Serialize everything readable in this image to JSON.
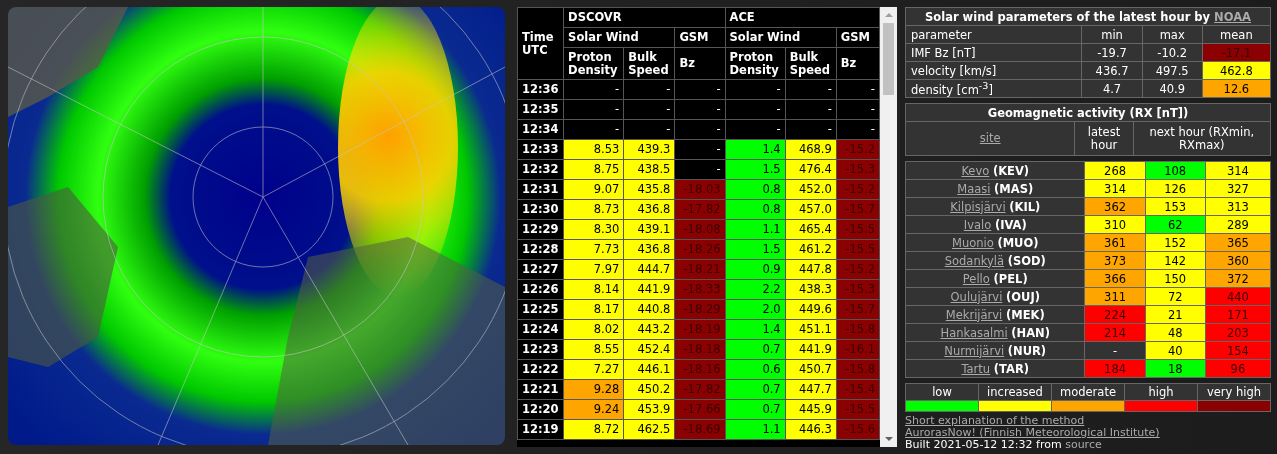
{
  "solar_table": {
    "col_time": "Time UTC",
    "groups": [
      "DSCOVR",
      "ACE"
    ],
    "subgroups": [
      "Solar Wind",
      "GSM",
      "Solar Wind",
      "GSM"
    ],
    "columns": [
      "Proton Density",
      "Bulk Speed",
      "Bz",
      "Proton Density",
      "Bulk Speed",
      "Bz"
    ],
    "rows": [
      {
        "time": "12:36",
        "cells": [
          {
            "value": "-"
          },
          {
            "value": "-"
          },
          {
            "value": "-"
          },
          {
            "value": "-"
          },
          {
            "value": "-"
          },
          {
            "value": "-"
          }
        ]
      },
      {
        "time": "12:35",
        "cells": [
          {
            "value": "-"
          },
          {
            "value": "-"
          },
          {
            "value": "-"
          },
          {
            "value": "-"
          },
          {
            "value": "-"
          },
          {
            "value": "-"
          }
        ]
      },
      {
        "time": "12:34",
        "cells": [
          {
            "value": "-"
          },
          {
            "value": "-"
          },
          {
            "value": "-"
          },
          {
            "value": "-"
          },
          {
            "value": "-"
          },
          {
            "value": "-"
          }
        ]
      },
      {
        "time": "12:33",
        "cells": [
          {
            "value": "8.53",
            "color": "#ffff00"
          },
          {
            "value": "439.3",
            "color": "#ffff00"
          },
          {
            "value": "-"
          },
          {
            "value": "1.4",
            "color": "#00ff00"
          },
          {
            "value": "468.9",
            "color": "#ffff00"
          },
          {
            "value": "-15.2",
            "color": "#8b0000"
          }
        ]
      },
      {
        "time": "12:32",
        "cells": [
          {
            "value": "8.75",
            "color": "#ffff00"
          },
          {
            "value": "438.5",
            "color": "#ffff00"
          },
          {
            "value": "-"
          },
          {
            "value": "1.5",
            "color": "#00ff00"
          },
          {
            "value": "476.4",
            "color": "#ffff00"
          },
          {
            "value": "-15.3",
            "color": "#8b0000"
          }
        ]
      },
      {
        "time": "12:31",
        "cells": [
          {
            "value": "9.07",
            "color": "#ffff00"
          },
          {
            "value": "435.8",
            "color": "#ffff00"
          },
          {
            "value": "-18.03",
            "color": "#8b0000"
          },
          {
            "value": "0.8",
            "color": "#00ff00"
          },
          {
            "value": "452.0",
            "color": "#ffff00"
          },
          {
            "value": "-15.2",
            "color": "#8b0000"
          }
        ]
      },
      {
        "time": "12:30",
        "cells": [
          {
            "value": "8.73",
            "color": "#ffff00"
          },
          {
            "value": "436.8",
            "color": "#ffff00"
          },
          {
            "value": "-17.82",
            "color": "#8b0000"
          },
          {
            "value": "0.8",
            "color": "#00ff00"
          },
          {
            "value": "457.0",
            "color": "#ffff00"
          },
          {
            "value": "-15.7",
            "color": "#8b0000"
          }
        ]
      },
      {
        "time": "12:29",
        "cells": [
          {
            "value": "8.30",
            "color": "#ffff00"
          },
          {
            "value": "439.1",
            "color": "#ffff00"
          },
          {
            "value": "-18.08",
            "color": "#8b0000"
          },
          {
            "value": "1.1",
            "color": "#00ff00"
          },
          {
            "value": "465.4",
            "color": "#ffff00"
          },
          {
            "value": "-15.5",
            "color": "#8b0000"
          }
        ]
      },
      {
        "time": "12:28",
        "cells": [
          {
            "value": "7.73",
            "color": "#ffff00"
          },
          {
            "value": "436.8",
            "color": "#ffff00"
          },
          {
            "value": "-18.26",
            "color": "#8b0000"
          },
          {
            "value": "1.5",
            "color": "#00ff00"
          },
          {
            "value": "461.2",
            "color": "#ffff00"
          },
          {
            "value": "-15.5",
            "color": "#8b0000"
          }
        ]
      },
      {
        "time": "12:27",
        "cells": [
          {
            "value": "7.97",
            "color": "#ffff00"
          },
          {
            "value": "444.7",
            "color": "#ffff00"
          },
          {
            "value": "-18.21",
            "color": "#8b0000"
          },
          {
            "value": "0.9",
            "color": "#00ff00"
          },
          {
            "value": "447.8",
            "color": "#ffff00"
          },
          {
            "value": "-15.2",
            "color": "#8b0000"
          }
        ]
      },
      {
        "time": "12:26",
        "cells": [
          {
            "value": "8.14",
            "color": "#ffff00"
          },
          {
            "value": "441.9",
            "color": "#ffff00"
          },
          {
            "value": "-18.33",
            "color": "#8b0000"
          },
          {
            "value": "2.2",
            "color": "#00ff00"
          },
          {
            "value": "438.3",
            "color": "#ffff00"
          },
          {
            "value": "-15.3",
            "color": "#8b0000"
          }
        ]
      },
      {
        "time": "12:25",
        "cells": [
          {
            "value": "8.17",
            "color": "#ffff00"
          },
          {
            "value": "440.8",
            "color": "#ffff00"
          },
          {
            "value": "-18.29",
            "color": "#8b0000"
          },
          {
            "value": "2.0",
            "color": "#00ff00"
          },
          {
            "value": "449.6",
            "color": "#ffff00"
          },
          {
            "value": "-15.7",
            "color": "#8b0000"
          }
        ]
      },
      {
        "time": "12:24",
        "cells": [
          {
            "value": "8.02",
            "color": "#ffff00"
          },
          {
            "value": "443.2",
            "color": "#ffff00"
          },
          {
            "value": "-18.19",
            "color": "#8b0000"
          },
          {
            "value": "1.4",
            "color": "#00ff00"
          },
          {
            "value": "451.1",
            "color": "#ffff00"
          },
          {
            "value": "-15.8",
            "color": "#8b0000"
          }
        ]
      },
      {
        "time": "12:23",
        "cells": [
          {
            "value": "8.55",
            "color": "#ffff00"
          },
          {
            "value": "452.4",
            "color": "#ffff00"
          },
          {
            "value": "-18.18",
            "color": "#8b0000"
          },
          {
            "value": "0.7",
            "color": "#00ff00"
          },
          {
            "value": "441.9",
            "color": "#ffff00"
          },
          {
            "value": "-16.1",
            "color": "#8b0000"
          }
        ]
      },
      {
        "time": "12:22",
        "cells": [
          {
            "value": "7.27",
            "color": "#ffff00"
          },
          {
            "value": "446.1",
            "color": "#ffff00"
          },
          {
            "value": "-18.16",
            "color": "#8b0000"
          },
          {
            "value": "0.6",
            "color": "#00ff00"
          },
          {
            "value": "450.7",
            "color": "#ffff00"
          },
          {
            "value": "-15.8",
            "color": "#8b0000"
          }
        ]
      },
      {
        "time": "12:21",
        "cells": [
          {
            "value": "9.28",
            "color": "#ffa500"
          },
          {
            "value": "450.2",
            "color": "#ffff00"
          },
          {
            "value": "-17.82",
            "color": "#8b0000"
          },
          {
            "value": "0.7",
            "color": "#00ff00"
          },
          {
            "value": "447.7",
            "color": "#ffff00"
          },
          {
            "value": "-15.4",
            "color": "#8b0000"
          }
        ]
      },
      {
        "time": "12:20",
        "cells": [
          {
            "value": "9.24",
            "color": "#ffa500"
          },
          {
            "value": "453.9",
            "color": "#ffff00"
          },
          {
            "value": "-17.66",
            "color": "#8b0000"
          },
          {
            "value": "0.7",
            "color": "#00ff00"
          },
          {
            "value": "445.9",
            "color": "#ffff00"
          },
          {
            "value": "-15.5",
            "color": "#8b0000"
          }
        ]
      },
      {
        "time": "12:19",
        "cells": [
          {
            "value": "8.72",
            "color": "#ffff00"
          },
          {
            "value": "462.5",
            "color": "#ffff00"
          },
          {
            "value": "-18.69",
            "color": "#8b0000"
          },
          {
            "value": "1.1",
            "color": "#00ff00"
          },
          {
            "value": "446.3",
            "color": "#ffff00"
          },
          {
            "value": "-15.6",
            "color": "#8b0000"
          }
        ]
      }
    ]
  },
  "noaa_table": {
    "title": "Solar wind parameters of the latest hour by",
    "title_link": "NOAA",
    "columns": [
      "parameter",
      "min",
      "max",
      "mean"
    ],
    "rows": [
      {
        "parameter": "IMF Bz [nT]",
        "min": "-19.7",
        "max": "-10.2",
        "mean": "-17.1",
        "color": "#8b0000"
      },
      {
        "parameter": "velocity [km/s]",
        "min": "436.7",
        "max": "497.5",
        "mean": "462.8",
        "color": "#ffff00"
      },
      {
        "parameter": "density [cm$^{-3}$]",
        "min": "4.7",
        "max": "40.9",
        "mean": "12.6",
        "color": "#ffa500"
      }
    ]
  },
  "geomagnetic_table": {
    "title": "Geomagnetic activity (RX [nT])",
    "col_site": "site",
    "col_latest": "latest hour",
    "col_next": "next hour (RXmin, RXmax)",
    "sites": [
      {
        "name": "Kevo",
        "code": "(KEV)",
        "latest": {
          "value": "268",
          "color": "#ffff00"
        },
        "min": {
          "value": "108",
          "color": "#00ff00"
        },
        "max": {
          "value": "314",
          "color": "#ffff00"
        }
      },
      {
        "name": "Maasi",
        "code": "(MAS)",
        "latest": {
          "value": "314",
          "color": "#ffff00"
        },
        "min": {
          "value": "126",
          "color": "#ffff00"
        },
        "max": {
          "value": "327",
          "color": "#ffff00"
        }
      },
      {
        "name": "Kilpisjärvi",
        "code": "(KIL)",
        "latest": {
          "value": "362",
          "color": "#ffa500"
        },
        "min": {
          "value": "153",
          "color": "#ffff00"
        },
        "max": {
          "value": "313",
          "color": "#ffff00"
        }
      },
      {
        "name": "Ivalo",
        "code": "(IVA)",
        "latest": {
          "value": "310",
          "color": "#ffff00"
        },
        "min": {
          "value": "62",
          "color": "#00ff00"
        },
        "max": {
          "value": "289",
          "color": "#ffff00"
        }
      },
      {
        "name": "Muonio",
        "code": "(MUO)",
        "latest": {
          "value": "361",
          "color": "#ffa500"
        },
        "min": {
          "value": "152",
          "color": "#ffff00"
        },
        "max": {
          "value": "365",
          "color": "#ffa500"
        }
      },
      {
        "name": "Sodankylä",
        "code": "(SOD)",
        "latest": {
          "value": "373",
          "color": "#ffa500"
        },
        "min": {
          "value": "142",
          "color": "#ffff00"
        },
        "max": {
          "value": "360",
          "color": "#ffa500"
        }
      },
      {
        "name": "Pello",
        "code": "(PEL)",
        "latest": {
          "value": "366",
          "color": "#ffa500"
        },
        "min": {
          "value": "150",
          "color": "#ffff00"
        },
        "max": {
          "value": "372",
          "color": "#ffa500"
        }
      },
      {
        "name": "Oulujärvi",
        "code": "(OUJ)",
        "latest": {
          "value": "311",
          "color": "#ffa500"
        },
        "min": {
          "value": "72",
          "color": "#ffff00"
        },
        "max": {
          "value": "440",
          "color": "#ff0000"
        }
      },
      {
        "name": "Mekrijärvi",
        "code": "(MEK)",
        "latest": {
          "value": "224",
          "color": "#ff0000"
        },
        "min": {
          "value": "21",
          "color": "#ffff00"
        },
        "max": {
          "value": "171",
          "color": "#ff0000"
        }
      },
      {
        "name": "Hankasalmi",
        "code": "(HAN)",
        "latest": {
          "value": "214",
          "color": "#ff0000"
        },
        "min": {
          "value": "48",
          "color": "#ffff00"
        },
        "max": {
          "value": "203",
          "color": "#ff0000"
        }
      },
      {
        "name": "Nurmijärvi",
        "code": "(NUR)",
        "latest": {
          "value": "-"
        },
        "min": {
          "value": "40",
          "color": "#ffff00"
        },
        "max": {
          "value": "154",
          "color": "#ff0000"
        }
      },
      {
        "name": "Tartu",
        "code": "(TAR)",
        "latest": {
          "value": "184",
          "color": "#ff0000"
        },
        "min": {
          "value": "18",
          "color": "#00ff00"
        },
        "max": {
          "value": "96",
          "color": "#ff0000"
        }
      }
    ]
  },
  "legend": [
    {
      "label": "low",
      "color": "#00ff00"
    },
    {
      "label": "increased",
      "color": "#ffff00"
    },
    {
      "label": "moderate",
      "color": "#ffa500"
    },
    {
      "label": "high",
      "color": "#ff0000"
    },
    {
      "label": "very high",
      "color": "#8b0000"
    }
  ],
  "footer": {
    "links": [
      "Short explanation of the method",
      "AurorasNow! (Finnish Meteorological Institute)"
    ],
    "built": "Built 2021-05-12 12:32 from",
    "source_link": "source"
  }
}
